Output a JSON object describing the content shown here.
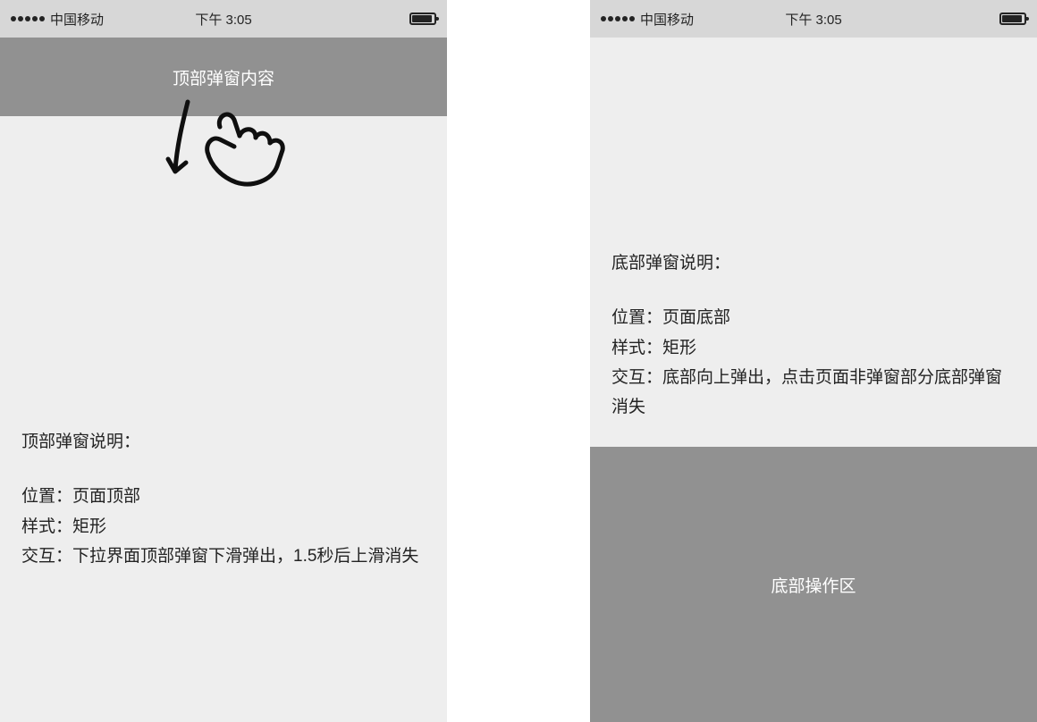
{
  "statusbar": {
    "carrier": "中国移动",
    "time": "下午 3:05"
  },
  "left_phone": {
    "banner_text": "顶部弹窗内容",
    "description": {
      "title": "顶部弹窗说明：",
      "position_line": "位置：页面顶部",
      "style_line": "样式：矩形",
      "interaction_line": "交互：下拉界面顶部弹窗下滑弹出，1.5秒后上滑消失"
    }
  },
  "right_phone": {
    "description": {
      "title": "底部弹窗说明：",
      "position_line": "位置：页面底部",
      "style_line": "样式：矩形",
      "interaction_line": "交互：底部向上弹出，点击页面非弹窗部分底部弹窗消失"
    },
    "bottom_area_text": "底部操作区"
  }
}
